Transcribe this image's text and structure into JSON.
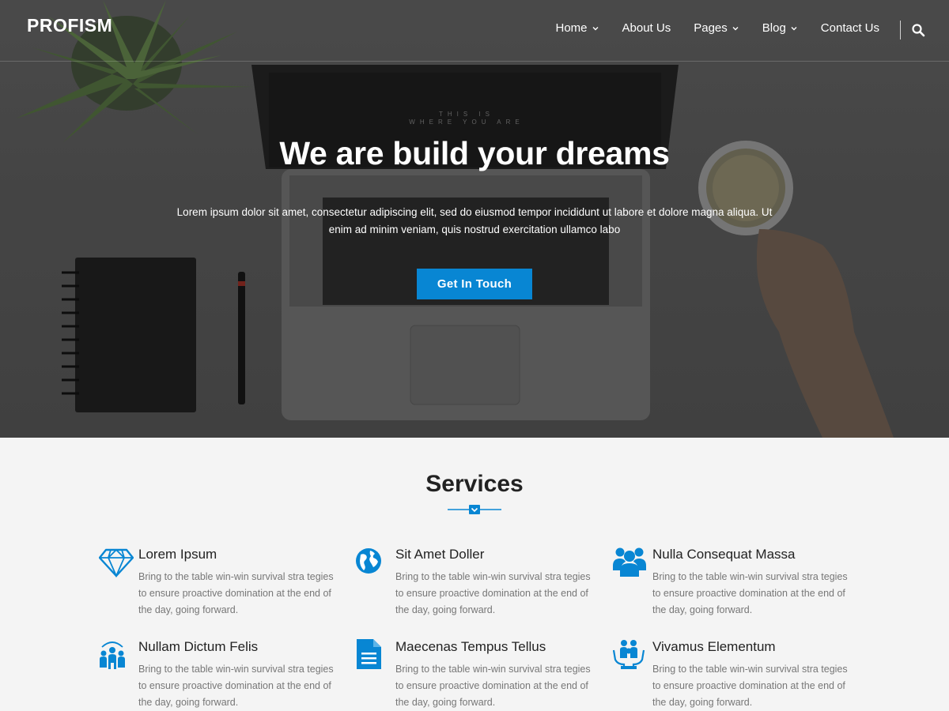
{
  "header": {
    "logo": "PROFISM",
    "nav": [
      {
        "label": "Home",
        "dropdown": true
      },
      {
        "label": "About Us",
        "dropdown": false
      },
      {
        "label": "Pages",
        "dropdown": true
      },
      {
        "label": "Blog",
        "dropdown": true
      },
      {
        "label": "Contact Us",
        "dropdown": false
      }
    ],
    "search_icon": "search-icon"
  },
  "hero": {
    "title": "We are build your dreams",
    "text": "Lorem ipsum dolor sit amet, consectetur adipiscing elit, sed do eiusmod tempor incididunt ut labore et dolore magna aliqua. Ut enim ad minim veniam, quis nostrud exercitation ullamco labo",
    "cta": "Get In Touch",
    "screen_text_1": "THIS IS",
    "screen_text_2": "WHERE YOU ARE"
  },
  "services": {
    "title": "Services",
    "items": [
      {
        "icon": "diamond-icon",
        "title": "Lorem Ipsum",
        "text": "Bring to the table win-win survival stra tegies to ensure proactive domination at the end of the day, going forward."
      },
      {
        "icon": "globe-icon",
        "title": "Sit Amet Doller",
        "text": "Bring to the table win-win survival stra tegies to ensure proactive domination at the end of the day, going forward."
      },
      {
        "icon": "users-icon",
        "title": "Nulla Consequat Massa",
        "text": "Bring to the table win-win survival stra tegies to ensure proactive domination at the end of the day, going forward."
      },
      {
        "icon": "team-icon",
        "title": "Nullam Dictum Felis",
        "text": "Bring to the table win-win survival stra tegies to ensure proactive domination at the end of the day, going forward."
      },
      {
        "icon": "document-icon",
        "title": "Maecenas Tempus Tellus",
        "text": "Bring to the table win-win survival stra tegies to ensure proactive domination at the end of the day, going forward."
      },
      {
        "icon": "care-icon",
        "title": "Vivamus Elementum",
        "text": "Bring to the table win-win survival stra tegies to ensure proactive domination at the end of the day, going forward."
      }
    ]
  },
  "colors": {
    "accent": "#0886d3",
    "heading": "#222222",
    "body_text": "#777777",
    "section_bg": "#f4f4f4"
  }
}
